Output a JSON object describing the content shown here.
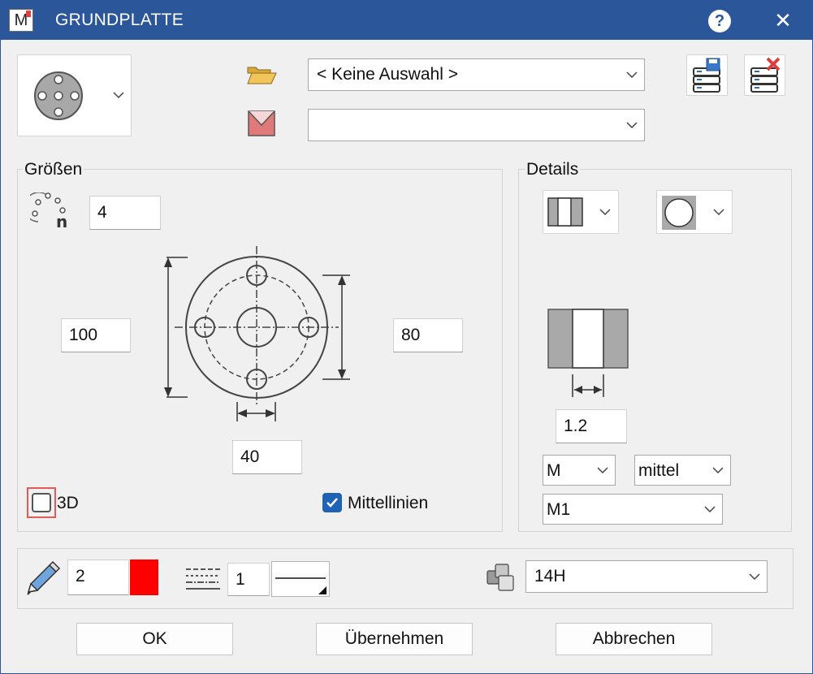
{
  "window": {
    "title": "GRUNDPLATTE",
    "help": "?",
    "close": "✕"
  },
  "top": {
    "style_combo_value": "< Keine Auswahl >",
    "second_combo_value": ""
  },
  "groessen": {
    "label": "Größen",
    "count": "4",
    "height": "100",
    "hole_spacing": "80",
    "hole_diameter": "40",
    "cb_3d_label": "3D",
    "cb_3d_checked": false,
    "cb_center_label": "Mittellinien",
    "cb_center_checked": true
  },
  "details": {
    "label": "Details",
    "thickness": "1.2",
    "thread_value": "M",
    "quality_value": "mittel",
    "type_value": "M1"
  },
  "format": {
    "pen": "2",
    "pen_color": "#ff0000",
    "line_type": "1",
    "layer": "14H"
  },
  "buttons": {
    "ok": "OK",
    "apply": "Übernehmen",
    "cancel": "Abbrechen"
  }
}
